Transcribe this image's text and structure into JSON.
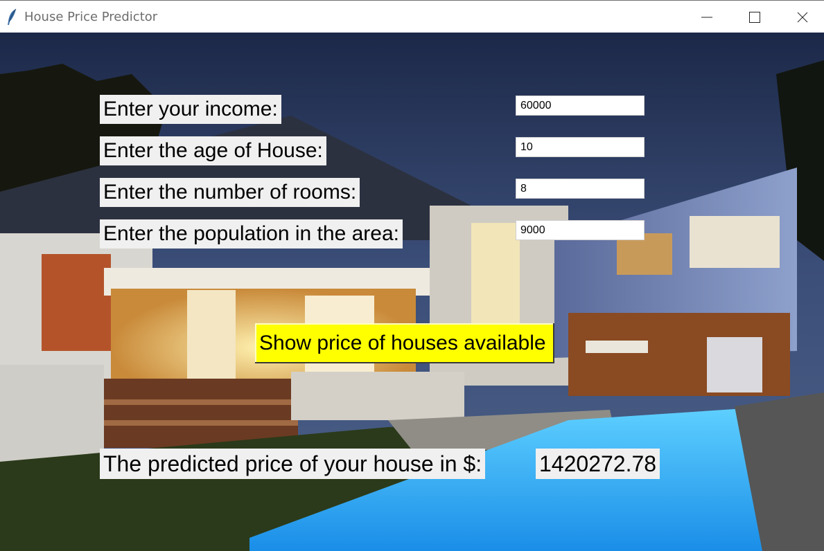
{
  "window": {
    "title": "House Price Predictor",
    "icon": "feather-icon",
    "controls": [
      "minimize-icon",
      "maximize-icon",
      "close-icon"
    ]
  },
  "form": {
    "income_label": "Enter your income:",
    "income_value": "60000",
    "age_label": "Enter the age of House:",
    "age_value": "10",
    "rooms_label": "Enter the number of rooms:",
    "rooms_value": "8",
    "population_label": "Enter the population in the area:",
    "population_value": "9000"
  },
  "action": {
    "label": "Show price of houses available",
    "color": "#ffff00"
  },
  "result": {
    "label": "The predicted price of your house in $:",
    "value": "1420272.78"
  }
}
